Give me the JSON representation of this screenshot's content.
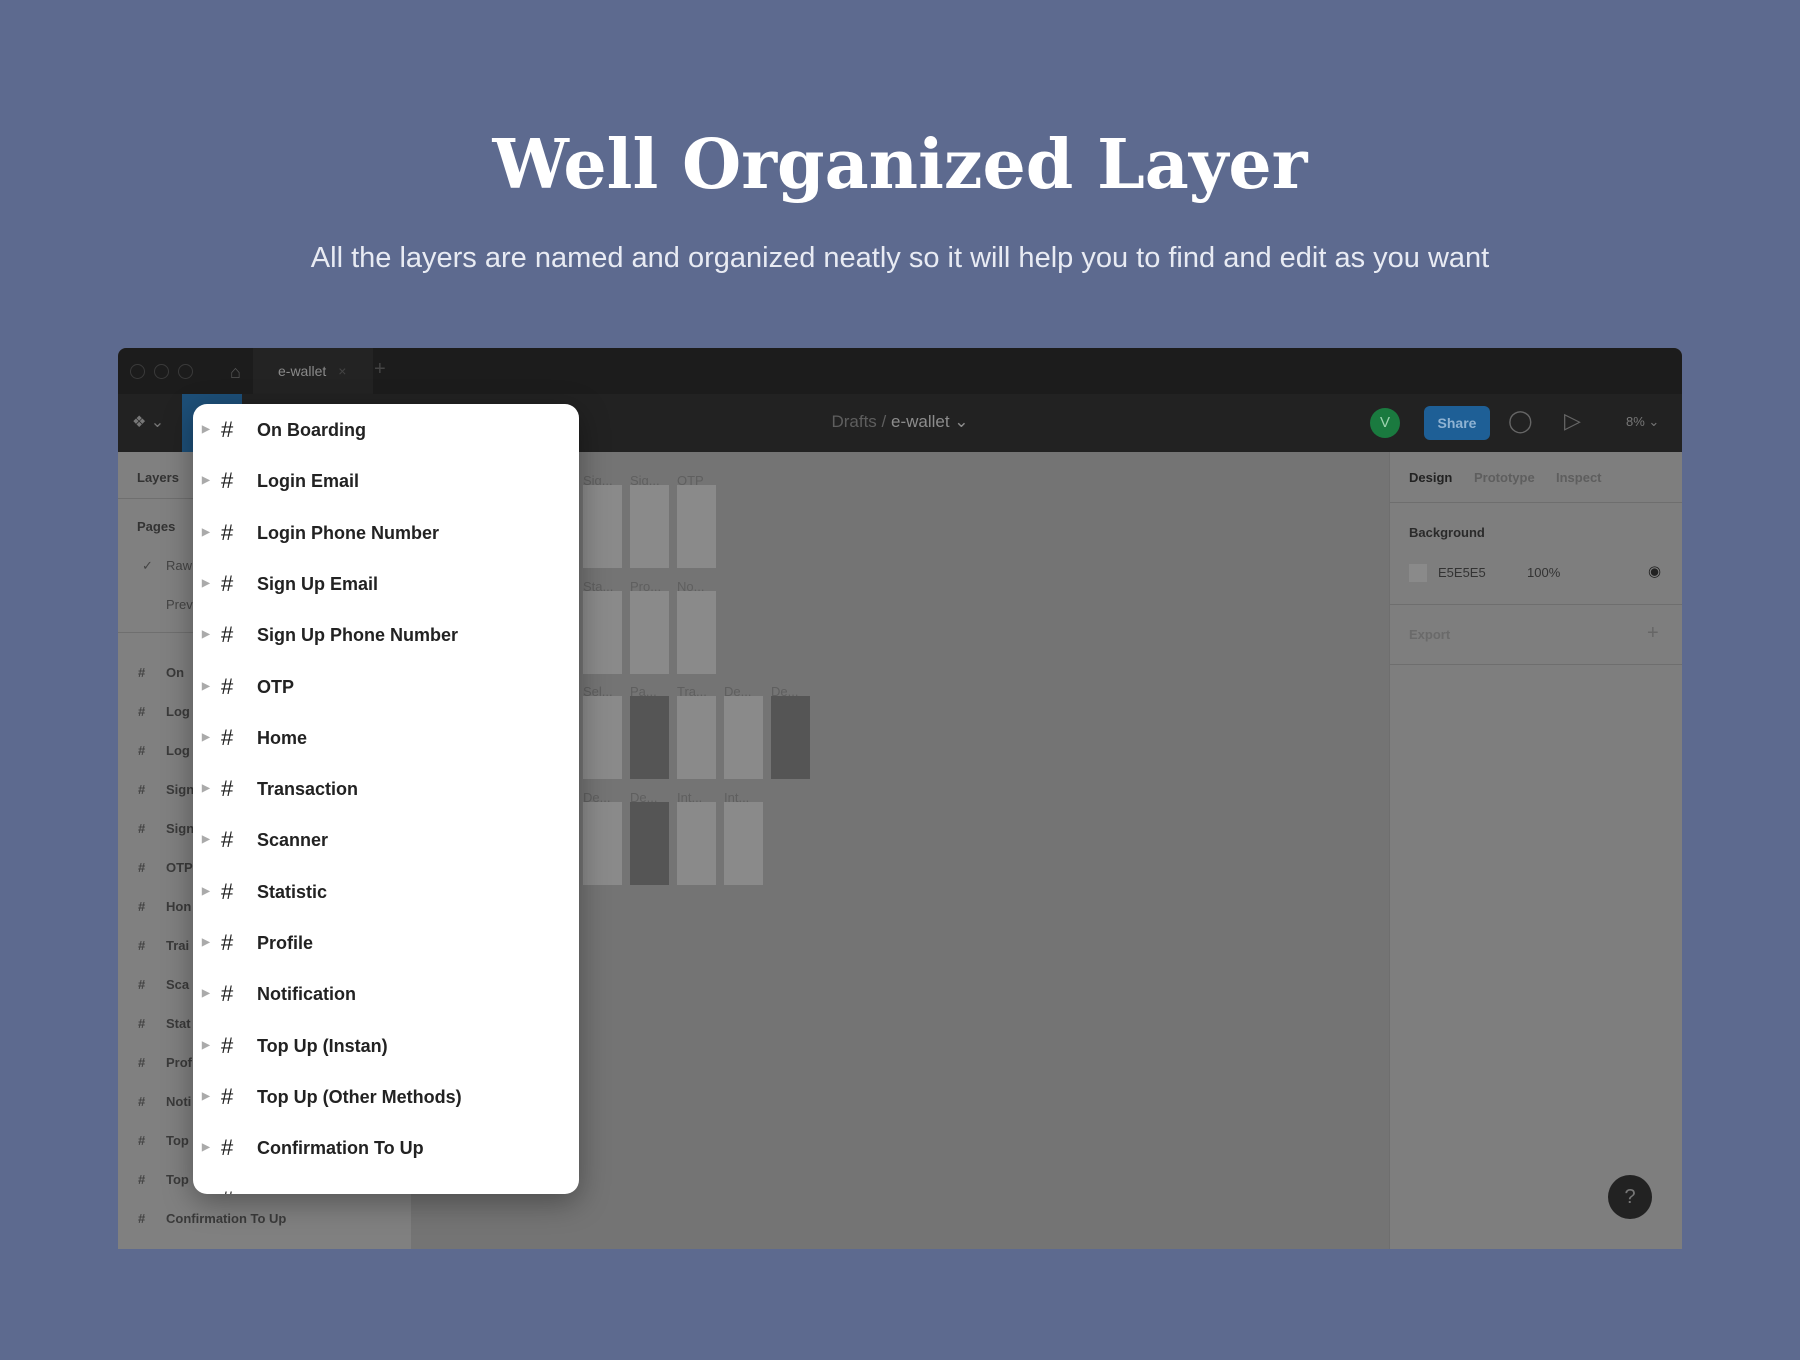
{
  "hero": {
    "title": "Well Organized Layer",
    "subtitle": "All the layers are named and organized neatly so it will help you to find and edit as you want"
  },
  "tabbar": {
    "tab": "e-wallet",
    "close": "×",
    "new_tab": "+"
  },
  "toolbar": {
    "breadcrumb_parent": "Drafts",
    "breadcrumb_sep": "/",
    "file": "e-wallet ⌄",
    "avatar": "V",
    "share": "Share",
    "zoom": "8% ⌄"
  },
  "left_panel": {
    "layers": "Layers",
    "pages_header": "Pages",
    "check": "✓",
    "pages": [
      "Raw",
      "Prev"
    ],
    "items": [
      "On",
      "Log",
      "Log",
      "Sign",
      "Sign",
      "OTP",
      "Hon",
      "Trai",
      "Sca",
      "Stat",
      "Prof",
      "Noti",
      "Top",
      "Top",
      "Confirmation To Up"
    ]
  },
  "right_panel": {
    "tabs": [
      "Design",
      "Prototype",
      "Inspect"
    ],
    "background_label": "Background",
    "bg_hex": "E5E5E5",
    "bg_opacity": "100%",
    "export_label": "Export",
    "add": "+"
  },
  "canvas": {
    "rows": [
      [
        "Sig...",
        "Sig...",
        "OTP"
      ],
      [
        "Sta...",
        "Pro...",
        "No..."
      ],
      [
        "Sel...",
        "Pa...",
        "Tra...",
        "De...",
        "De..."
      ],
      [
        "De...",
        "De...",
        "Int...",
        "Int..."
      ]
    ],
    "dark": [
      [
        false,
        false,
        false
      ],
      [
        false,
        false,
        false
      ],
      [
        false,
        true,
        false,
        false,
        true
      ],
      [
        false,
        true,
        false,
        false
      ]
    ]
  },
  "popup": {
    "items": [
      "On Boarding",
      "Login Email",
      "Login Phone Number",
      "Sign Up Email",
      "Sign Up Phone Number",
      "OTP",
      "Home",
      "Transaction",
      "Scanner",
      "Statistic",
      "Profile",
      "Notification",
      "Top Up (Instan)",
      "Top Up (Other Methods)",
      "Confirmation To Up"
    ]
  },
  "help": "?",
  "colors": {
    "page_bg": "#5d6a8f",
    "share": "#1e5f96",
    "avatar": "#1a7a3f"
  }
}
